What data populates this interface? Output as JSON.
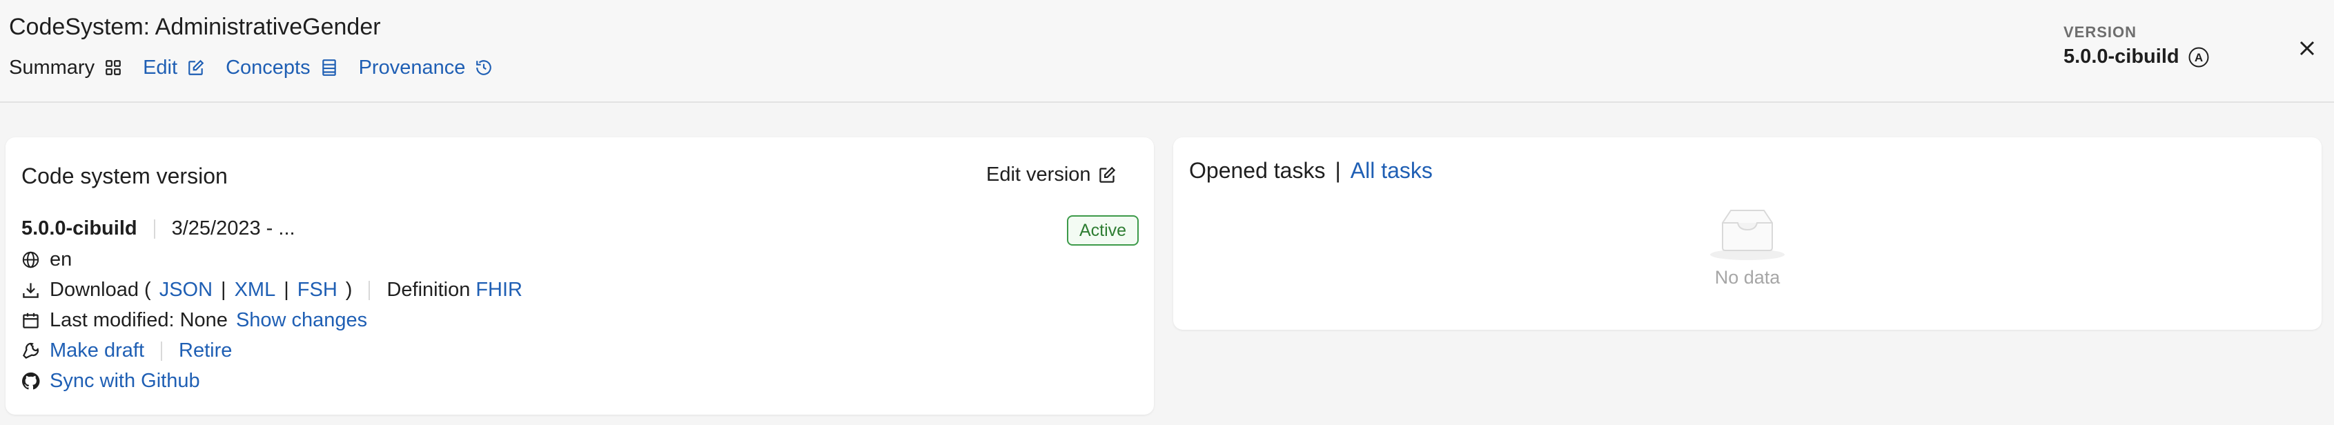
{
  "header": {
    "title": "CodeSystem: AdministrativeGender",
    "nav": {
      "summary": "Summary",
      "edit": "Edit",
      "concepts": "Concepts",
      "provenance": "Provenance"
    },
    "version_label": "VERSION",
    "version_value": "5.0.0-cibuild",
    "version_badge": "A"
  },
  "version_card": {
    "title": "Code system version",
    "edit_version": "Edit version",
    "status": "Active",
    "version": "5.0.0-cibuild",
    "date_range": "3/25/2023 - ...",
    "language": "en",
    "download_prefix": "Download (",
    "download_json": "JSON",
    "download_xml": "XML",
    "download_fsh": "FSH",
    "download_suffix": ")",
    "pipe": "|",
    "definition_label": "Definition",
    "definition_link": "FHIR",
    "last_modified": "Last modified: None",
    "show_changes": "Show changes",
    "make_draft": "Make draft",
    "retire": "Retire",
    "sync_github": "Sync with Github"
  },
  "tasks_card": {
    "title": "Opened tasks",
    "separator": "|",
    "all_tasks": "All tasks",
    "empty_text": "No data"
  },
  "colors": {
    "link": "#1f5fb4",
    "active_green": "#2e7d32",
    "background": "#f5f5f5"
  }
}
